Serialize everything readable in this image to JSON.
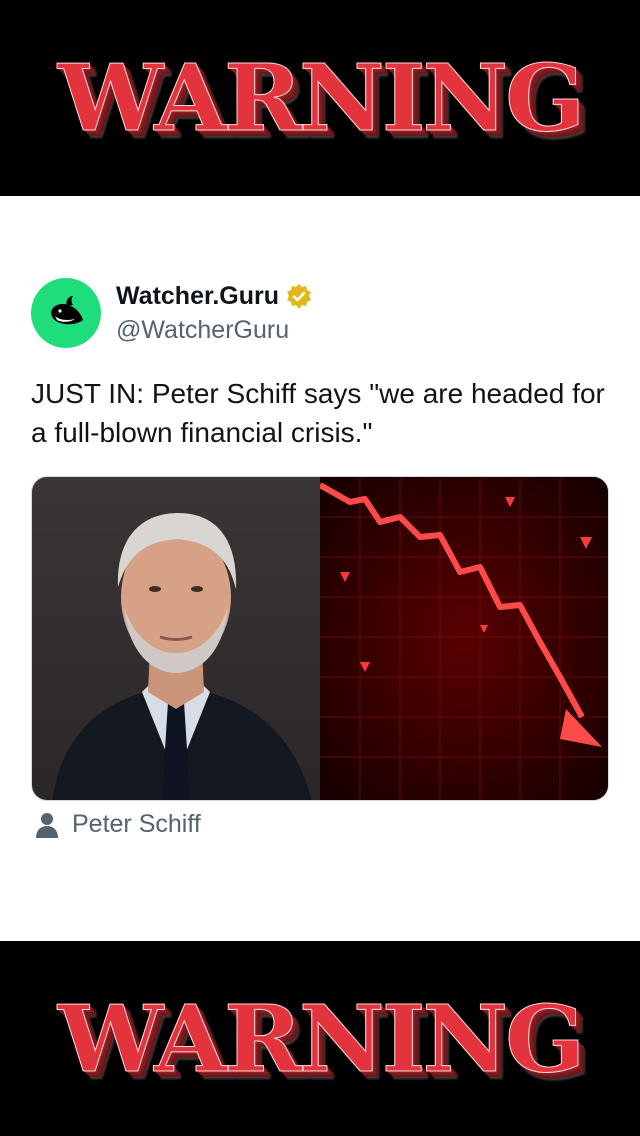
{
  "banner": {
    "top_text": "WARNING",
    "bottom_text": "WARNING"
  },
  "tweet": {
    "display_name": "Watcher.Guru",
    "handle": "@WatcherGuru",
    "verified": true,
    "text": "JUST IN: Peter Schiff says \"we are headed for a full-blown financial crisis.\"",
    "media_caption": "Peter Schiff"
  },
  "colors": {
    "warning_red": "#e3343e",
    "avatar_green": "#1fdd7a",
    "verified_gold": "#e2b719",
    "muted_text": "#536471"
  },
  "icons": {
    "avatar": "whale-logo-icon",
    "verified": "verified-badge-icon",
    "caption": "person-icon"
  }
}
